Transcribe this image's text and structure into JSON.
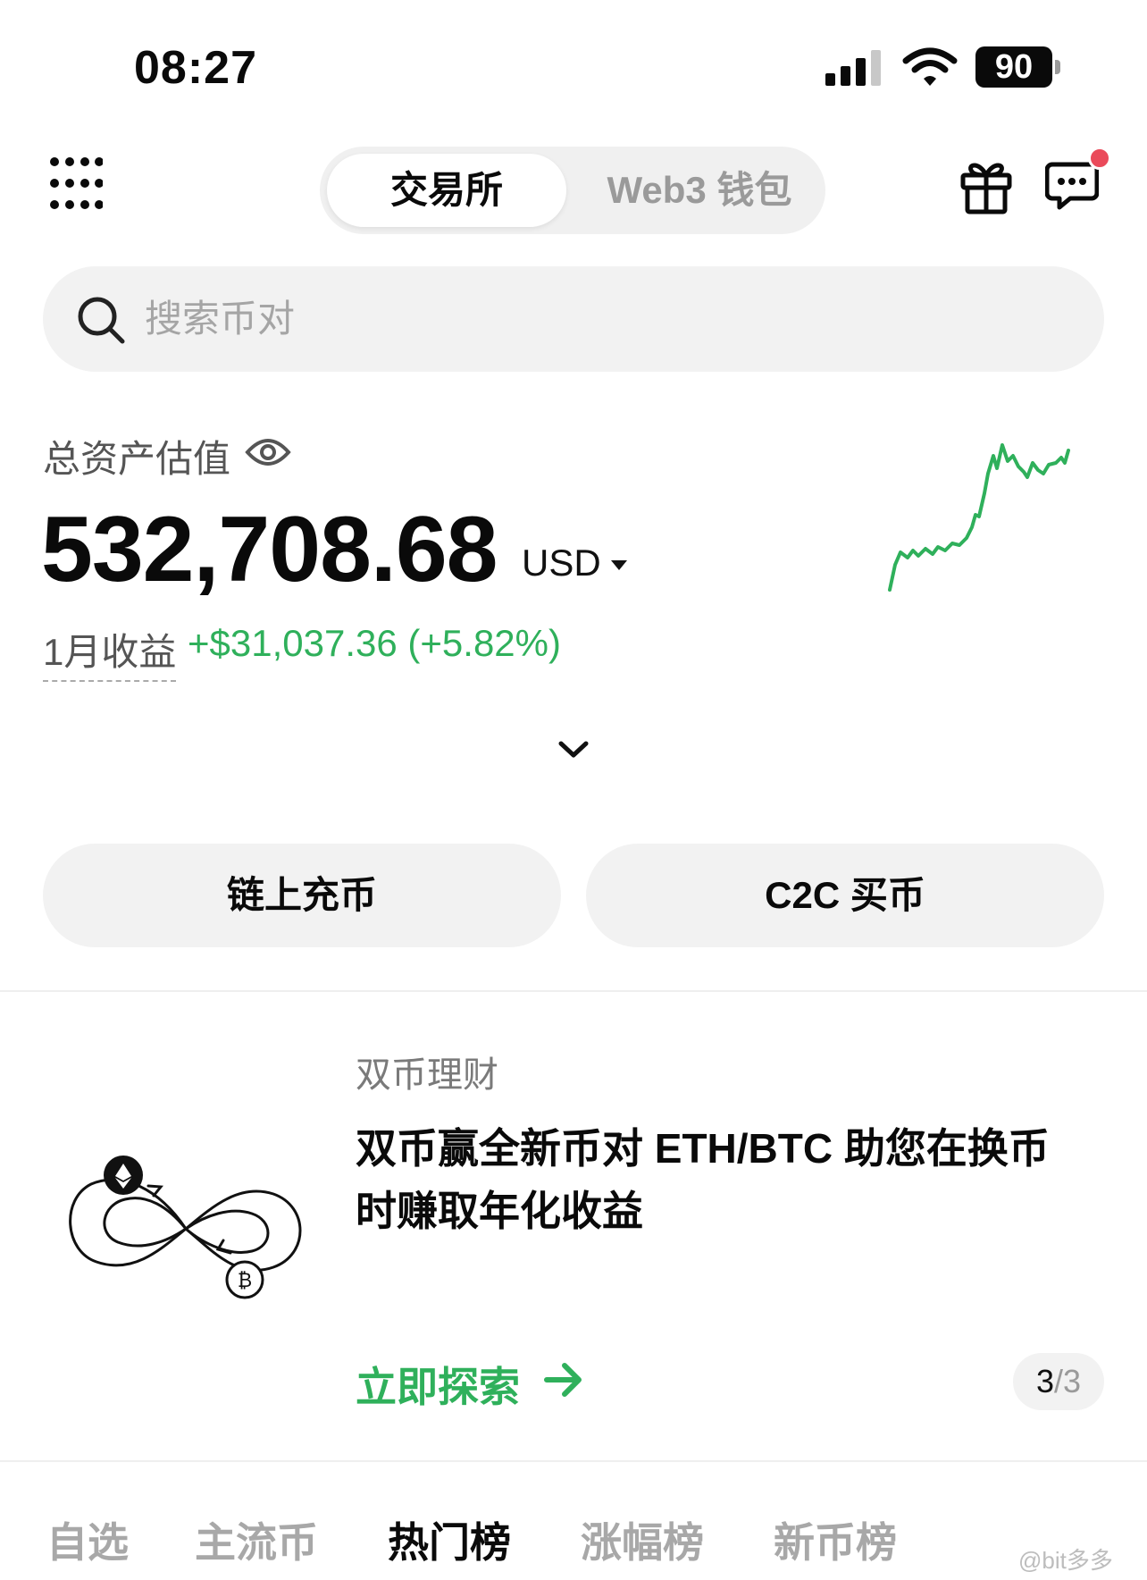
{
  "status_bar": {
    "time": "08:27",
    "battery": "90"
  },
  "header": {
    "segments": [
      {
        "label": "交易所",
        "active": true
      },
      {
        "label": "Web3 钱包",
        "active": false
      }
    ],
    "has_notification": true
  },
  "search": {
    "placeholder": "搜索币对"
  },
  "assets": {
    "label": "总资产估值",
    "value": "532,708.68",
    "unit": "USD",
    "pnl_label": "1月收益",
    "pnl_value": "+$31,037.36 (+5.82%)",
    "trend_color": "#2fb05b"
  },
  "actions": {
    "deposit": "链上充币",
    "c2c": "C2C 买币"
  },
  "promo": {
    "tag": "双币理财",
    "title": "双币赢全新币对 ETH/BTC 助您在换币时赚取年化收益",
    "cta": "立即探索",
    "art_coins": [
      "ETH",
      "BTC"
    ],
    "pager_current": "3",
    "pager_total": "/3"
  },
  "tabs": [
    {
      "label": "自选",
      "active": false
    },
    {
      "label": "主流币",
      "active": false
    },
    {
      "label": "热门榜",
      "active": true
    },
    {
      "label": "涨幅榜",
      "active": false
    },
    {
      "label": "新币榜",
      "active": false
    }
  ],
  "watermark": "@bit多多",
  "colors": {
    "accent_green": "#2fb05b",
    "notification_red": "#ea4a5a"
  }
}
